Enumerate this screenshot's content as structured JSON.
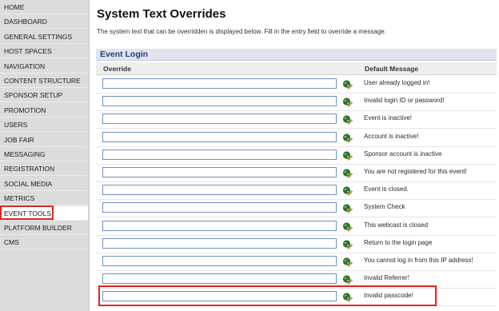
{
  "sidebar": {
    "items": [
      {
        "label": "HOME"
      },
      {
        "label": "DASHBOARD"
      },
      {
        "label": "GENERAL SETTINGS"
      },
      {
        "label": "HOST SPACES"
      },
      {
        "label": "NAVIGATION"
      },
      {
        "label": "CONTENT STRUCTURE"
      },
      {
        "label": "SPONSOR SETUP"
      },
      {
        "label": "PROMOTION"
      },
      {
        "label": "USERS"
      },
      {
        "label": "JOB FAIR"
      },
      {
        "label": "MESSAGING"
      },
      {
        "label": "REGISTRATION"
      },
      {
        "label": "SOCIAL MEDIA"
      },
      {
        "label": "METRICS"
      },
      {
        "label": "EVENT TOOLS"
      },
      {
        "label": "PLATFORM BUILDER"
      },
      {
        "label": "CMS"
      }
    ],
    "active_label": "EVENT TOOLS"
  },
  "page": {
    "title": "System Text Overrides",
    "description": "The system text that can be overridden is displayed below. Fill in the entry field to override a message."
  },
  "section": {
    "title": "Event Login",
    "override_header": "Override",
    "default_header": "Default Message",
    "rows": [
      {
        "override": "",
        "default": "User already logged in!"
      },
      {
        "override": "",
        "default": "Invalid login ID or password!"
      },
      {
        "override": "",
        "default": "Event is inactive!"
      },
      {
        "override": "",
        "default": "Account is inactive!"
      },
      {
        "override": "",
        "default": "Sponsor account is inactive"
      },
      {
        "override": "",
        "default": "You are not registered for this event!"
      },
      {
        "override": "",
        "default": "Event is closed."
      },
      {
        "override": "",
        "default": "System Check"
      },
      {
        "override": "",
        "default": "This webcast is closed"
      },
      {
        "override": "",
        "default": "Return to the login page"
      },
      {
        "override": "",
        "default": "You cannot log in from this IP address!"
      },
      {
        "override": "",
        "default": "Invalid Referrer!"
      },
      {
        "override": "",
        "default": "Invalid passcode!"
      }
    ]
  },
  "icons": {
    "row_action": "globe-edit-icon"
  },
  "colors": {
    "highlight": "#e02424",
    "section_title": "#2a3a7a",
    "input_border": "#6f93c4"
  }
}
